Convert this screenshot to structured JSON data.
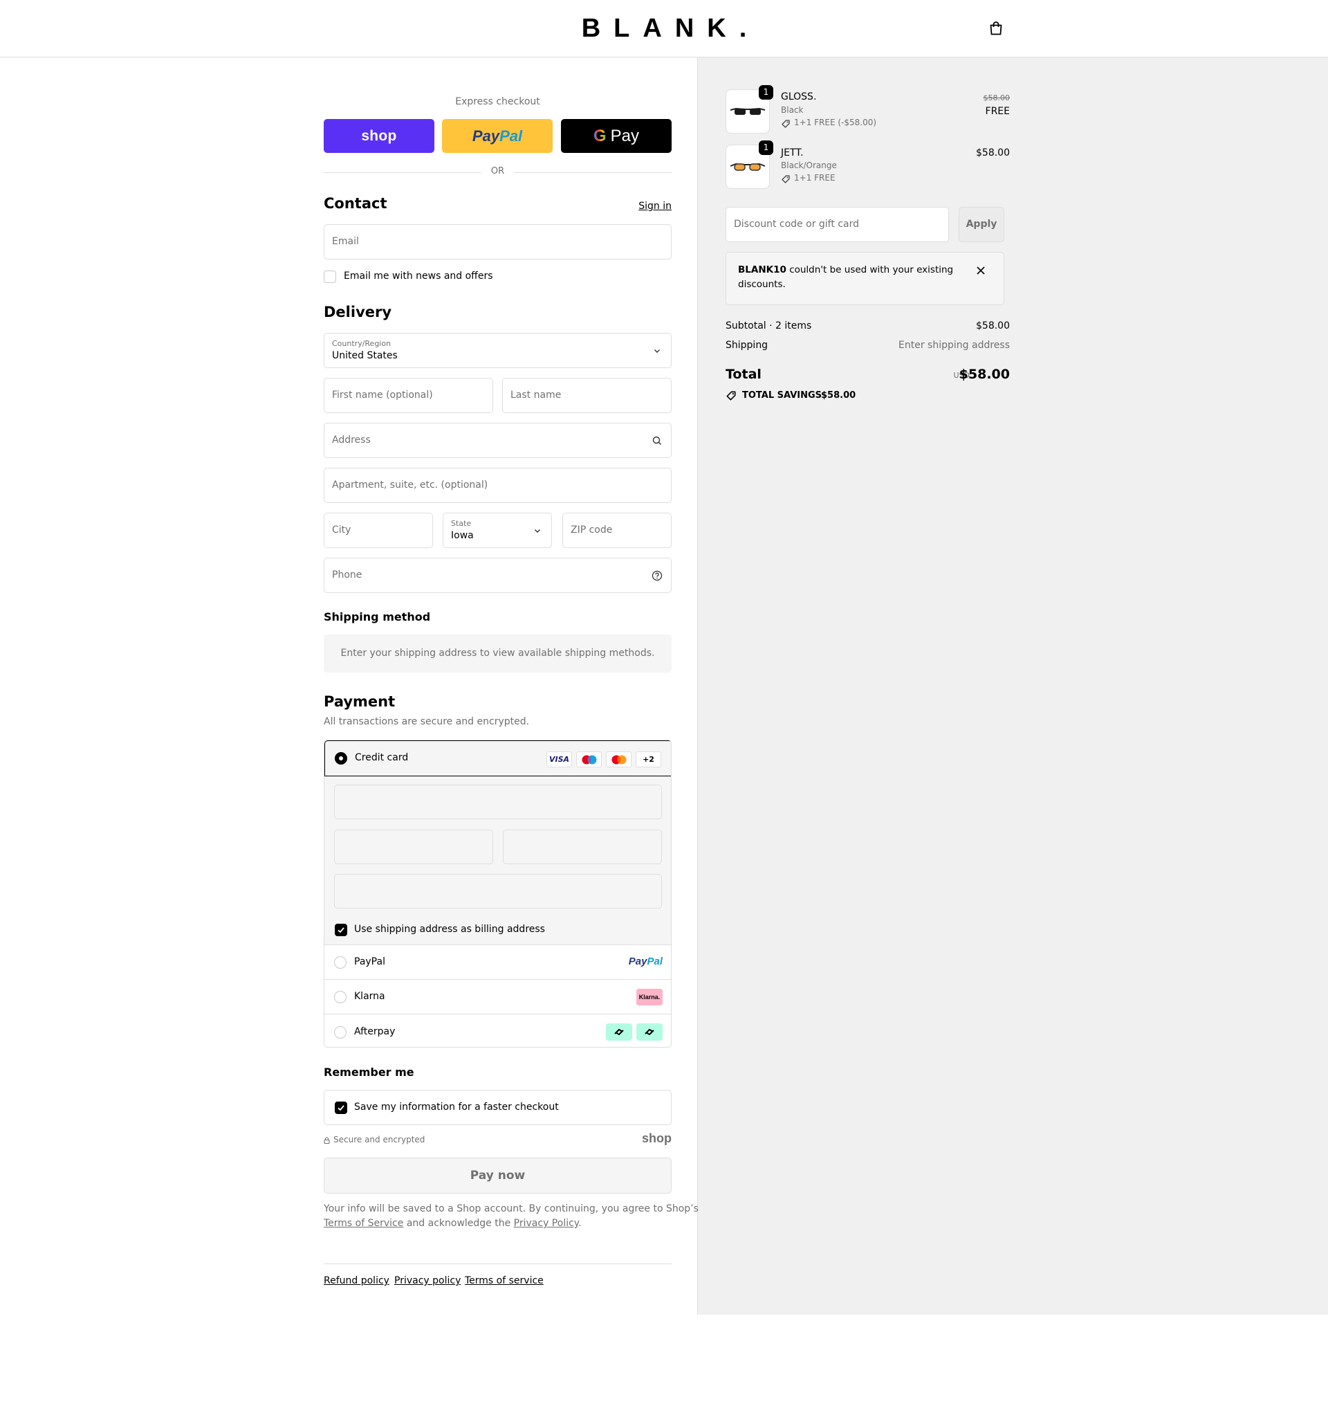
{
  "header": {
    "logo": "BLANK.",
    "cart_icon": "shopping-bag-icon"
  },
  "express": {
    "label": "Express checkout",
    "shop_label": "shop",
    "paypal_label_1": "Pay",
    "paypal_label_2": "Pal",
    "gpay_g": "G",
    "gpay_label": "Pay",
    "or": "OR"
  },
  "contact": {
    "title": "Contact",
    "sign_in": "Sign in",
    "email_placeholder": "Email",
    "news_label": "Email me with news and offers",
    "news_checked": false
  },
  "delivery": {
    "title": "Delivery",
    "country_label": "Country/Region",
    "country_value": "United States",
    "first_name_placeholder": "First name (optional)",
    "last_name_placeholder": "Last name",
    "address_placeholder": "Address",
    "apartment_placeholder": "Apartment, suite, etc. (optional)",
    "city_placeholder": "City",
    "state_label": "State",
    "state_value": "Iowa",
    "zip_placeholder": "ZIP code",
    "phone_placeholder": "Phone"
  },
  "shipping_method": {
    "title": "Shipping method",
    "message": "Enter your shipping address to view available shipping methods."
  },
  "payment": {
    "title": "Payment",
    "subtitle": "All transactions are secure and encrypted.",
    "credit_card_label": "Credit card",
    "card_badges": [
      "VISA",
      "maestro",
      "mastercard",
      "+2"
    ],
    "billing_label": "Use shipping address as billing address",
    "billing_checked": true,
    "paypal_label": "PayPal",
    "paypal_logo_1": "Pay",
    "paypal_logo_2": "Pal",
    "klarna_label": "Klarna",
    "klarna_logo": "Klarna.",
    "afterpay_label": "Afterpay"
  },
  "remember": {
    "title": "Remember me",
    "save_label": "Save my information for a faster checkout",
    "save_checked": true,
    "secure_label": "Secure and encrypted",
    "shop_logo": "shop"
  },
  "pay_now": "Pay now",
  "legal": {
    "part1": "Your info will be saved to a Shop account. By continuing, you agree to Shop’s",
    "terms": "Terms of Service",
    "part2": "and acknowledge the",
    "privacy": "Privacy Policy",
    "end": "."
  },
  "footer_links": [
    "Refund policy",
    "Privacy policy",
    "Terms of service"
  ],
  "cart": {
    "items": [
      {
        "qty": "1",
        "name": "GLOSS.",
        "variant": "Black",
        "promo": "1+1 FREE (-$58.00)",
        "original_price": "$58.00",
        "price": "FREE",
        "lens_color": "#1a1a1a"
      },
      {
        "qty": "1",
        "name": "JETT.",
        "variant": "Black/Orange",
        "promo": "1+1 FREE",
        "price": "$58.00",
        "lens_color": "#f2a53b"
      }
    ],
    "discount_placeholder": "Discount code or gift card",
    "apply_label": "Apply",
    "alert_code": "BLANK10",
    "alert_message_1": "couldn't be used with your existing",
    "alert_message_2": "discounts.",
    "subtotal_label": "Subtotal · 2 items",
    "subtotal_value": "$58.00",
    "shipping_label": "Shipping",
    "shipping_value": "Enter shipping address",
    "total_label": "Total",
    "currency": "USD",
    "total_value": "$58.00",
    "savings_label": "TOTAL SAVINGS",
    "savings_value": "$58.00"
  },
  "colors": {
    "shop_purple": "#5a31f4",
    "paypal_yellow": "#ffc439",
    "panel_gray": "#f0f0f0",
    "afterpay_mint": "#b2fce4",
    "klarna_pink": "#ffb3c7"
  }
}
